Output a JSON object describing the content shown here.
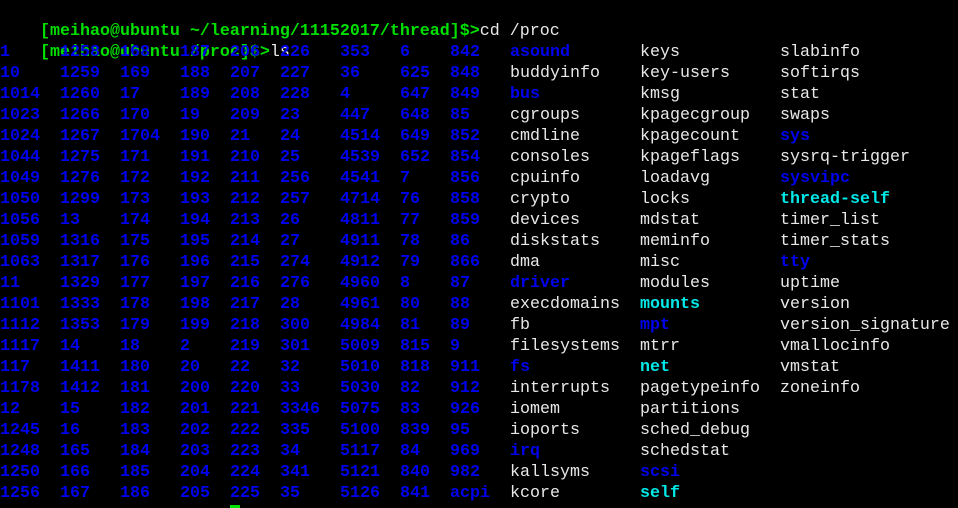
{
  "terminal": {
    "lines": [
      {
        "prompt": "[meihao@ubuntu ~/learning/11152017/thread]$>",
        "command": "cd /proc"
      },
      {
        "prompt": "[meihao@ubuntu /proc]$>",
        "command": "ls"
      }
    ],
    "colors": {
      "prompt": "#00e000",
      "directory": "#0000ee",
      "symlink": "#00e8e8",
      "file": "#e8e8e8",
      "background": "#000000"
    },
    "ls_columns": [
      [
        "1",
        "10",
        "1014",
        "1023",
        "1024",
        "1044",
        "1049",
        "1050",
        "1056",
        "1059",
        "1063",
        "11",
        "1101",
        "1112",
        "1117",
        "117",
        "1178",
        "12",
        "1245",
        "1248",
        "1250",
        "1256"
      ],
      [
        "1258",
        "1259",
        "1260",
        "1266",
        "1267",
        "1275",
        "1276",
        "1299",
        "13",
        "1316",
        "1317",
        "1329",
        "1333",
        "1353",
        "14",
        "1411",
        "1412",
        "15",
        "16",
        "165",
        "166",
        "167"
      ],
      [
        "168",
        "169",
        "17",
        "170",
        "1704",
        "171",
        "172",
        "173",
        "174",
        "175",
        "176",
        "177",
        "178",
        "179",
        "18",
        "180",
        "181",
        "182",
        "183",
        "184",
        "185",
        "186"
      ],
      [
        "187",
        "188",
        "189",
        "19",
        "190",
        "191",
        "192",
        "193",
        "194",
        "195",
        "196",
        "197",
        "198",
        "199",
        "2",
        "20",
        "200",
        "201",
        "202",
        "203",
        "204",
        "205"
      ],
      [
        "206",
        "207",
        "208",
        "209",
        "21",
        "210",
        "211",
        "212",
        "213",
        "214",
        "215",
        "216",
        "217",
        "218",
        "219",
        "22",
        "220",
        "221",
        "222",
        "223",
        "224",
        "225"
      ],
      [
        "226",
        "227",
        "228",
        "23",
        "24",
        "25",
        "256",
        "257",
        "26",
        "27",
        "274",
        "276",
        "28",
        "300",
        "301",
        "32",
        "33",
        "3346",
        "335",
        "34",
        "341",
        "35"
      ],
      [
        "353",
        "36",
        "4",
        "447",
        "4514",
        "4539",
        "4541",
        "4714",
        "4811",
        "4911",
        "4912",
        "4960",
        "4961",
        "4984",
        "5009",
        "5010",
        "5030",
        "5075",
        "5100",
        "5117",
        "5121",
        "5126"
      ],
      [
        "6",
        "625",
        "647",
        "648",
        "649",
        "652",
        "7",
        "76",
        "77",
        "78",
        "79",
        "8",
        "80",
        "81",
        "815",
        "818",
        "82",
        "83",
        "839",
        "84",
        "840",
        "841"
      ],
      [
        "842",
        "848",
        "849",
        "85",
        "852",
        "854",
        "856",
        "858",
        "859",
        "86",
        "866",
        "87",
        "88",
        "89",
        "9",
        "911",
        "912",
        "926",
        "95",
        "969",
        "982",
        "acpi"
      ],
      [
        "asound",
        "buddyinfo",
        "bus",
        "cgroups",
        "cmdline",
        "consoles",
        "cpuinfo",
        "crypto",
        "devices",
        "diskstats",
        "dma",
        "driver",
        "execdomains",
        "fb",
        "filesystems",
        "fs",
        "interrupts",
        "iomem",
        "ioports",
        "irq",
        "kallsyms",
        "kcore"
      ],
      [
        "keys",
        "key-users",
        "kmsg",
        "kpagecgroup",
        "kpagecount",
        "kpageflags",
        "loadavg",
        "locks",
        "mdstat",
        "meminfo",
        "misc",
        "modules",
        "mounts",
        "mpt",
        "mtrr",
        "net",
        "pagetypeinfo",
        "partitions",
        "sched_debug",
        "schedstat",
        "scsi",
        "self"
      ],
      [
        "slabinfo",
        "softirqs",
        "stat",
        "swaps",
        "sys",
        "sysrq-trigger",
        "sysvipc",
        "thread-self",
        "timer_list",
        "timer_stats",
        "tty",
        "uptime",
        "version",
        "version_signature",
        "vmallocinfo",
        "vmstat",
        "zoneinfo"
      ]
    ],
    "named_directories": [
      "acpi",
      "asound",
      "bus",
      "driver",
      "fs",
      "irq",
      "mpt",
      "scsi",
      "sys",
      "sysvipc",
      "tty"
    ],
    "symlinks": [
      "mounts",
      "net",
      "self",
      "thread-self"
    ]
  }
}
